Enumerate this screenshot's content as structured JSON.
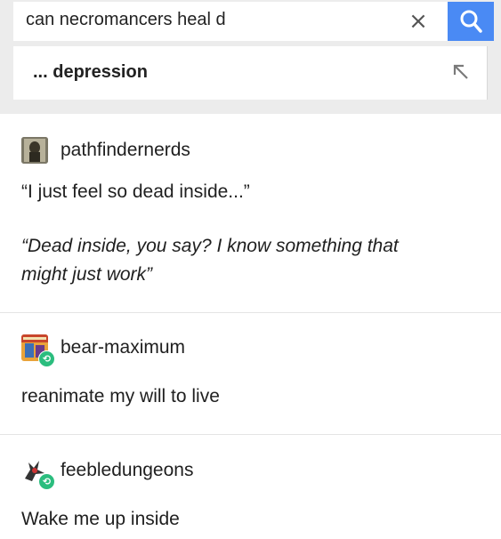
{
  "search": {
    "query": "can necromancers heal d",
    "clear_symbol": "×",
    "suggestion": "... depression"
  },
  "posts": [
    {
      "username": "pathfindernerds",
      "avatar_icon": "dark-figure-avatar",
      "lines": [
        "“I just feel so dead inside...”"
      ],
      "quote_line1": "“Dead inside, you say? I know something that",
      "quote_line2": "might just work”"
    },
    {
      "username": "bear-maximum",
      "avatar_icon": "colorful-book-avatar",
      "reblog": true,
      "text": "reanimate my will to live"
    },
    {
      "username": "feebledungeons",
      "avatar_icon": "dragon-sketch-avatar",
      "reblog": true,
      "text": "Wake me up inside"
    }
  ],
  "colors": {
    "search_button": "#4a8af4",
    "reblog_badge": "#2bbd7e"
  }
}
